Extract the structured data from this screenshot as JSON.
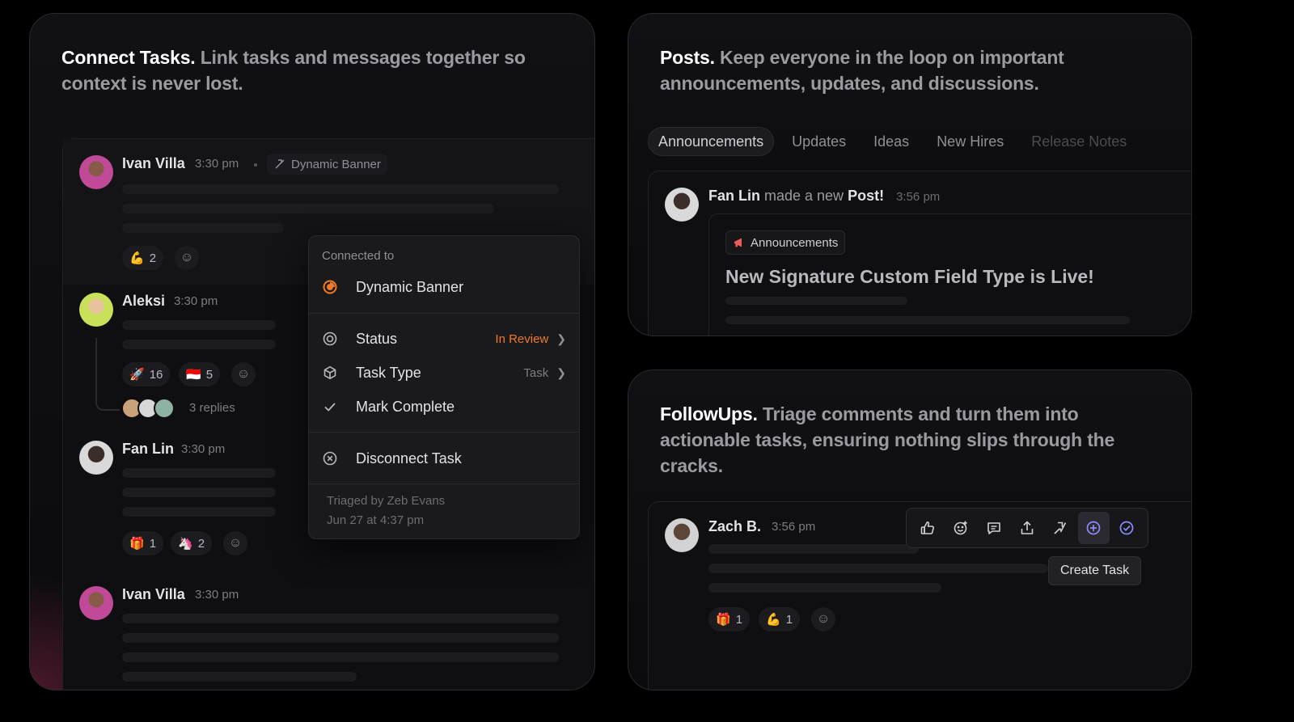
{
  "connect": {
    "headline_strong": "Connect Tasks.",
    "headline_soft": " Link tasks and messages together so context is never lost.",
    "messages": [
      {
        "name": "Ivan Villa",
        "time": "3:30 pm",
        "chip": "Dynamic Banner",
        "reactions": [
          {
            "emoji": "💪",
            "count": "2"
          }
        ]
      },
      {
        "name": "Aleksi",
        "time": "3:30 pm",
        "reactions": [
          {
            "emoji": "🚀",
            "count": "16"
          },
          {
            "emoji": "🇮🇩",
            "count": "5"
          }
        ],
        "replies": "3 replies"
      },
      {
        "name": "Fan Lin",
        "time": "3:30 pm",
        "reactions": [
          {
            "emoji": "🎁",
            "count": "1"
          },
          {
            "emoji": "🦄",
            "count": "2"
          }
        ]
      },
      {
        "name": "Ivan Villa",
        "time": "3:30 pm"
      }
    ],
    "popover": {
      "connected_label": "Connected to",
      "connected_task": "Dynamic Banner",
      "status_label": "Status",
      "status_value": "In Review",
      "status_color": "#f07a2a",
      "task_type_label": "Task Type",
      "task_type_value": "Task",
      "mark_complete": "Mark Complete",
      "disconnect": "Disconnect Task",
      "triaged_by": "Triaged by Zeb Evans",
      "triaged_date": "Jun 27 at 4:37 pm"
    }
  },
  "posts": {
    "headline_strong": "Posts.",
    "headline_soft": " Keep everyone in the loop on important announcements, updates, and discussions.",
    "tabs": [
      "Announcements",
      "Updates",
      "Ideas",
      "New Hires",
      "Release Notes"
    ],
    "active_tab": "Announcements",
    "post": {
      "author": "Fan Lin",
      "action": " made a new ",
      "action_strong": "Post!",
      "time": "3:56 pm",
      "channel": "Announcements",
      "title": "New Signature Custom Field Type is Live!"
    }
  },
  "followups": {
    "headline_strong": "FollowUps.",
    "headline_soft": " Triage comments and turn them into actionable tasks, ensuring nothing slips through the cracks.",
    "message": {
      "name": "Zach B.",
      "time": "3:56 pm",
      "reactions": [
        {
          "emoji": "🎁",
          "count": "1"
        },
        {
          "emoji": "💪",
          "count": "1"
        }
      ]
    },
    "toolbar_icons": [
      "thumbs-up-icon",
      "add-reaction-icon",
      "comment-icon",
      "share-icon",
      "link-task-icon",
      "create-task-icon",
      "check-circle-icon"
    ],
    "tooltip": "Create Task",
    "accent": "#8f8cff"
  }
}
